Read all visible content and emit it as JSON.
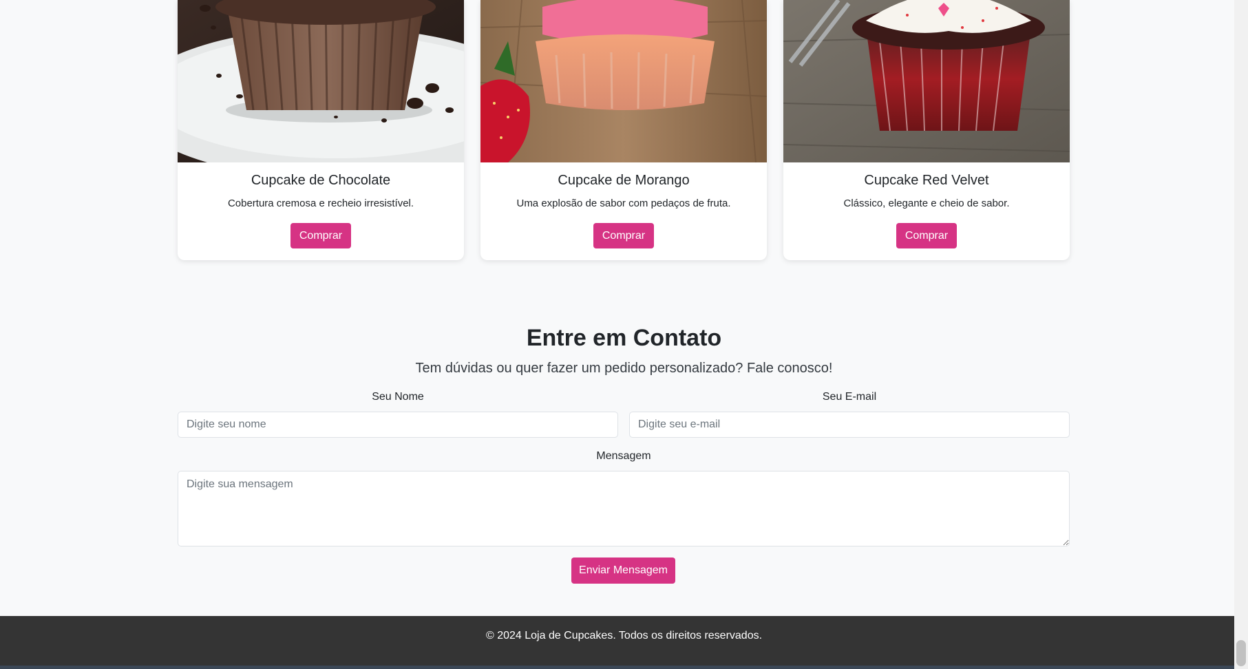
{
  "products": [
    {
      "title": "Cupcake de Chocolate",
      "description": "Cobertura cremosa e recheio irresistível.",
      "button_label": "Comprar"
    },
    {
      "title": "Cupcake de Morango",
      "description": "Uma explosão de sabor com pedaços de fruta.",
      "button_label": "Comprar"
    },
    {
      "title": "Cupcake Red Velvet",
      "description": "Clássico, elegante e cheio de sabor.",
      "button_label": "Comprar"
    }
  ],
  "contact": {
    "title": "Entre em Contato",
    "subtitle": "Tem dúvidas ou quer fazer um pedido personalizado? Fale conosco!",
    "name_label": "Seu Nome",
    "name_placeholder": "Digite seu nome",
    "email_label": "Seu E-mail",
    "email_placeholder": "Digite seu e-mail",
    "message_label": "Mensagem",
    "message_placeholder": "Digite sua mensagem",
    "submit_label": "Enviar Mensagem"
  },
  "footer": {
    "text": "© 2024 Loja de Cupcakes. Todos os direitos reservados."
  },
  "colors": {
    "accent": "#d63384",
    "footer_bg": "#343434",
    "page_bg": "#f8f9fa"
  }
}
